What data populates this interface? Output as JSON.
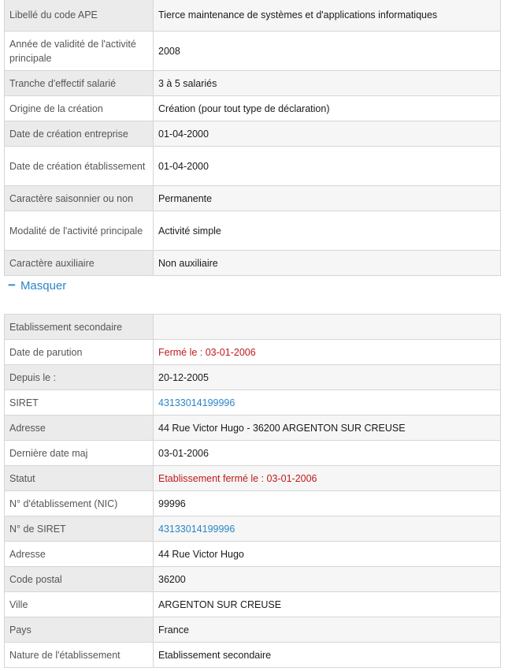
{
  "main_activity": {
    "rows": [
      {
        "label": "Libellé du code APE",
        "value": "Tierce maintenance de systèmes et d'applications informatiques"
      },
      {
        "label": "Année de validité de l'activité principale",
        "value": "2008"
      },
      {
        "label": "Tranche d'effectif salarié",
        "value": "3 à 5 salariés"
      },
      {
        "label": "Origine de la création",
        "value": "Création (pour tout type de déclaration)"
      },
      {
        "label": "Date de création entreprise",
        "value": "01-04-2000"
      },
      {
        "label": "Date de création établissement",
        "value": "01-04-2000"
      },
      {
        "label": "Caractère saisonnier ou non",
        "value": "Permanente"
      },
      {
        "label": "Modalité de l'activité principale",
        "value": "Activité simple"
      },
      {
        "label": "Caractère auxiliaire",
        "value": "Non auxiliaire"
      }
    ]
  },
  "toggle": {
    "label": "Masquer",
    "icon": "minus-icon"
  },
  "establishment": {
    "rows": [
      {
        "label": "Etablissement secondaire",
        "value": ""
      },
      {
        "label": "Date de parution",
        "value": "Fermé le : 03-01-2006"
      },
      {
        "label": "Depuis le :",
        "value": "20-12-2005"
      },
      {
        "label": "SIRET",
        "value": "43133014199996"
      },
      {
        "label": "Adresse",
        "value": "44 Rue Victor Hugo - 36200 ARGENTON SUR CREUSE"
      },
      {
        "label": "Dernière date maj",
        "value": "03-01-2006"
      },
      {
        "label": "Statut",
        "value": "Etablissement fermé le : 03-01-2006"
      },
      {
        "label": "N° d'établissement (NIC)",
        "value": "99996"
      },
      {
        "label": "N° de SIRET",
        "value": "43133014199996"
      },
      {
        "label": "Adresse",
        "value": "44 Rue Victor Hugo"
      },
      {
        "label": "Code postal",
        "value": "36200"
      },
      {
        "label": "Ville",
        "value": "ARGENTON SUR CREUSE"
      },
      {
        "label": "Pays",
        "value": "France"
      },
      {
        "label": "Nature de l'établissement",
        "value": "Etablissement secondaire"
      }
    ]
  },
  "colors": {
    "link": "#2a86c8",
    "closed": "#c01a1a",
    "label_bg": "#ebebeb",
    "value_bg": "#f6f6f6"
  }
}
